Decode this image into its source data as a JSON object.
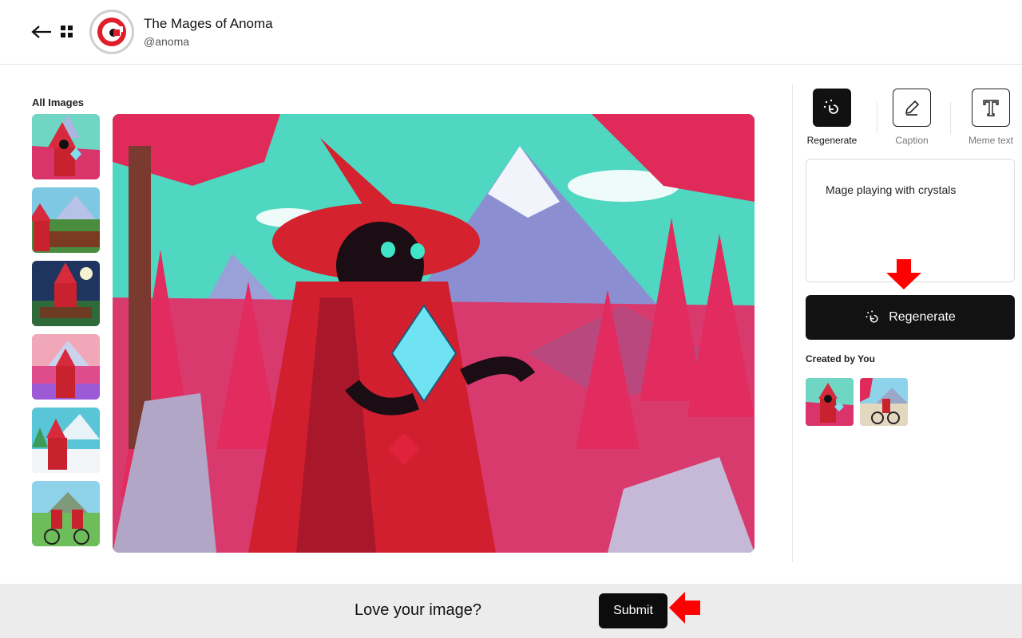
{
  "header": {
    "title": "The Mages of Anoma",
    "handle": "@anoma"
  },
  "gallery": {
    "label": "All Images",
    "thumbnails": [
      "mage-crystal",
      "mage-market",
      "mage-night-table",
      "mage-mountains",
      "mage-snow",
      "mages-bicycles"
    ]
  },
  "tools": [
    {
      "label": "Regenerate",
      "icon": "regenerate-icon",
      "active": true
    },
    {
      "label": "Caption",
      "icon": "pencil-icon",
      "active": false
    },
    {
      "label": "Meme text",
      "icon": "text-icon",
      "active": false
    }
  ],
  "prompt": {
    "value": "Mage playing with crystals"
  },
  "regenerate_button": {
    "label": "Regenerate"
  },
  "created": {
    "label": "Created by You",
    "thumbnails": [
      "mage-crystal",
      "mage-bicycle"
    ]
  },
  "footer": {
    "prompt_text": "Love your image?",
    "submit_label": "Submit"
  },
  "colors": {
    "accent": "#121212",
    "annotation_arrow": "#ff0000",
    "footer_bg": "#ececec"
  }
}
